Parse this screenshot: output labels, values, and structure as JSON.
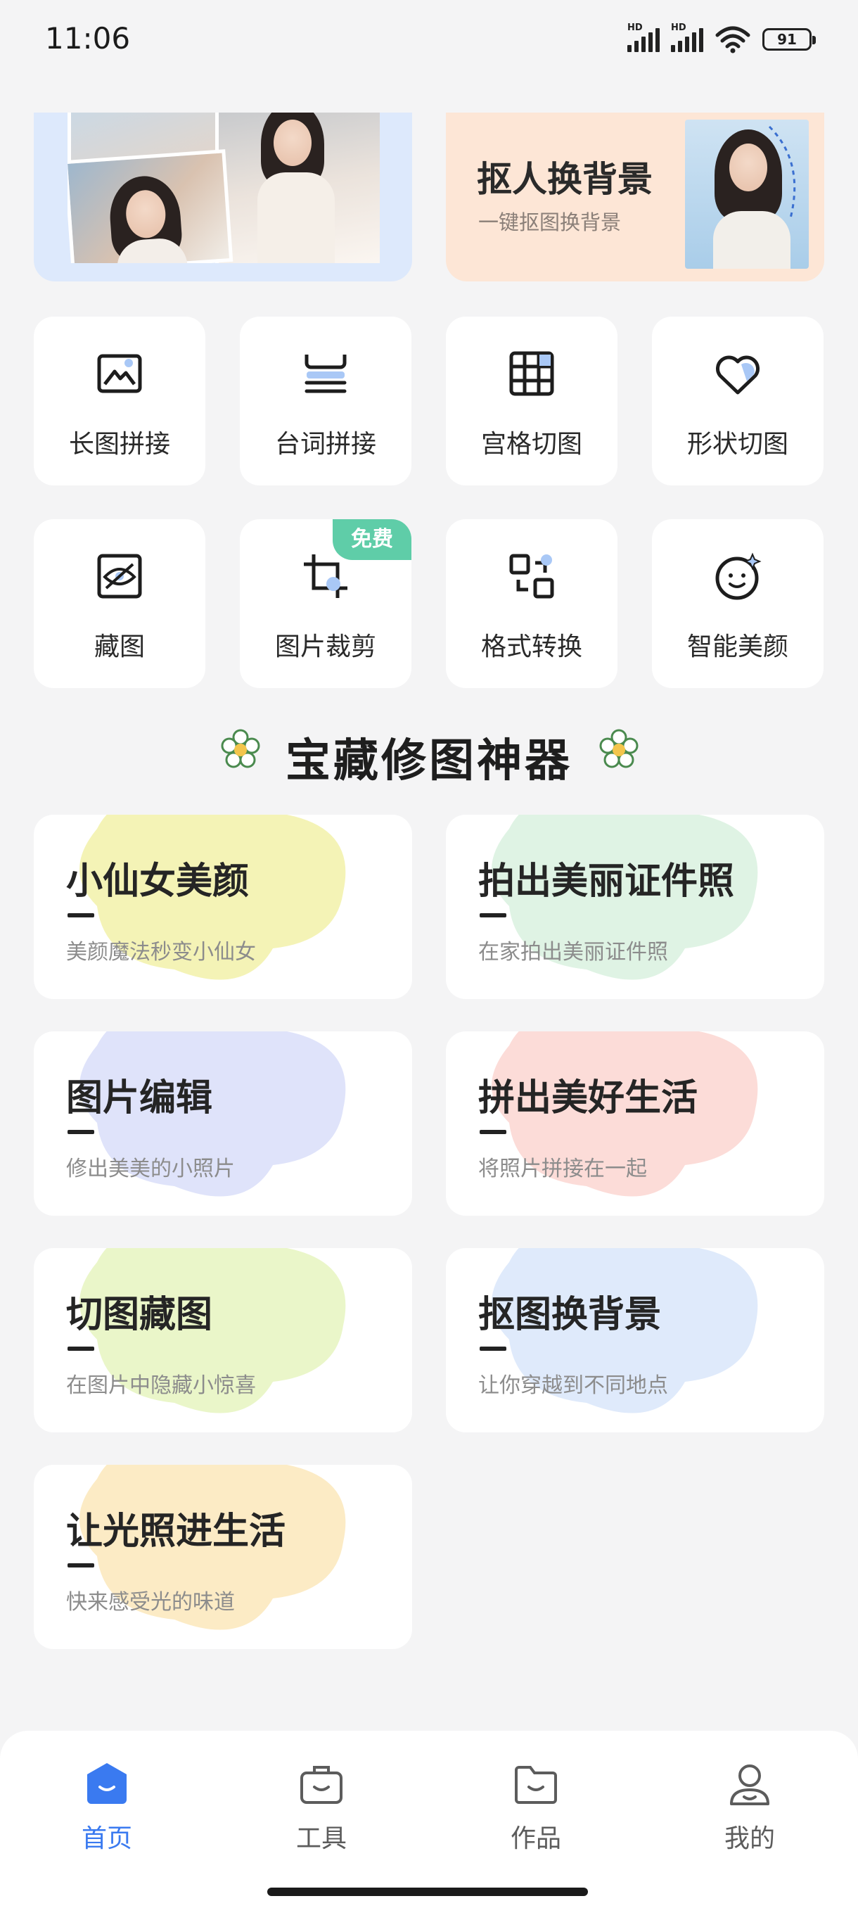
{
  "status_bar": {
    "time": "11:06",
    "battery": "91",
    "signal_labels": [
      "HD",
      "HD"
    ]
  },
  "banners": {
    "left": {
      "name": "collage-banner"
    },
    "right": {
      "title": "抠人换背景",
      "subtitle": "一键抠图换背景"
    }
  },
  "tools": [
    {
      "label": "长图拼接",
      "icon": "long-image-icon"
    },
    {
      "label": "台词拼接",
      "icon": "subtitle-stitch-icon"
    },
    {
      "label": "宫格切图",
      "icon": "grid-cut-icon"
    },
    {
      "label": "形状切图",
      "icon": "heart-shape-icon"
    },
    {
      "label": "藏图",
      "icon": "hidden-eye-icon"
    },
    {
      "label": "图片裁剪",
      "icon": "crop-icon",
      "badge": "免费"
    },
    {
      "label": "格式转换",
      "icon": "convert-icon"
    },
    {
      "label": "智能美颜",
      "icon": "smart-beauty-icon"
    }
  ],
  "section": {
    "title": "宝藏修图神器"
  },
  "cards": [
    {
      "title": "小仙女美颜",
      "subtitle": "美颜魔法秒变小仙女",
      "color": "#f4f3b6"
    },
    {
      "title": "拍出美丽证件照",
      "subtitle": "在家拍出美丽证件照",
      "color": "#dff3e4"
    },
    {
      "title": "图片编辑",
      "subtitle": "修出美美的小照片",
      "color": "#dfe3fa"
    },
    {
      "title": "拼出美好生活",
      "subtitle": "将照片拼接在一起",
      "color": "#fcdcd8"
    },
    {
      "title": "切图藏图",
      "subtitle": "在图片中隐藏小惊喜",
      "color": "#eaf6c9"
    },
    {
      "title": "抠图换背景",
      "subtitle": "让你穿越到不同地点",
      "color": "#dfeafb"
    },
    {
      "title": "让光照进生活",
      "subtitle": "快来感受光的味道",
      "color": "#fcebc5"
    }
  ],
  "nav": [
    {
      "label": "首页",
      "icon": "home-icon",
      "active": true
    },
    {
      "label": "工具",
      "icon": "toolbox-icon",
      "active": false
    },
    {
      "label": "作品",
      "icon": "folder-icon",
      "active": false
    },
    {
      "label": "我的",
      "icon": "profile-icon",
      "active": false
    }
  ],
  "colors": {
    "accent": "#3a7af0",
    "badge": "#5fcda8",
    "background": "#f4f4f5"
  }
}
